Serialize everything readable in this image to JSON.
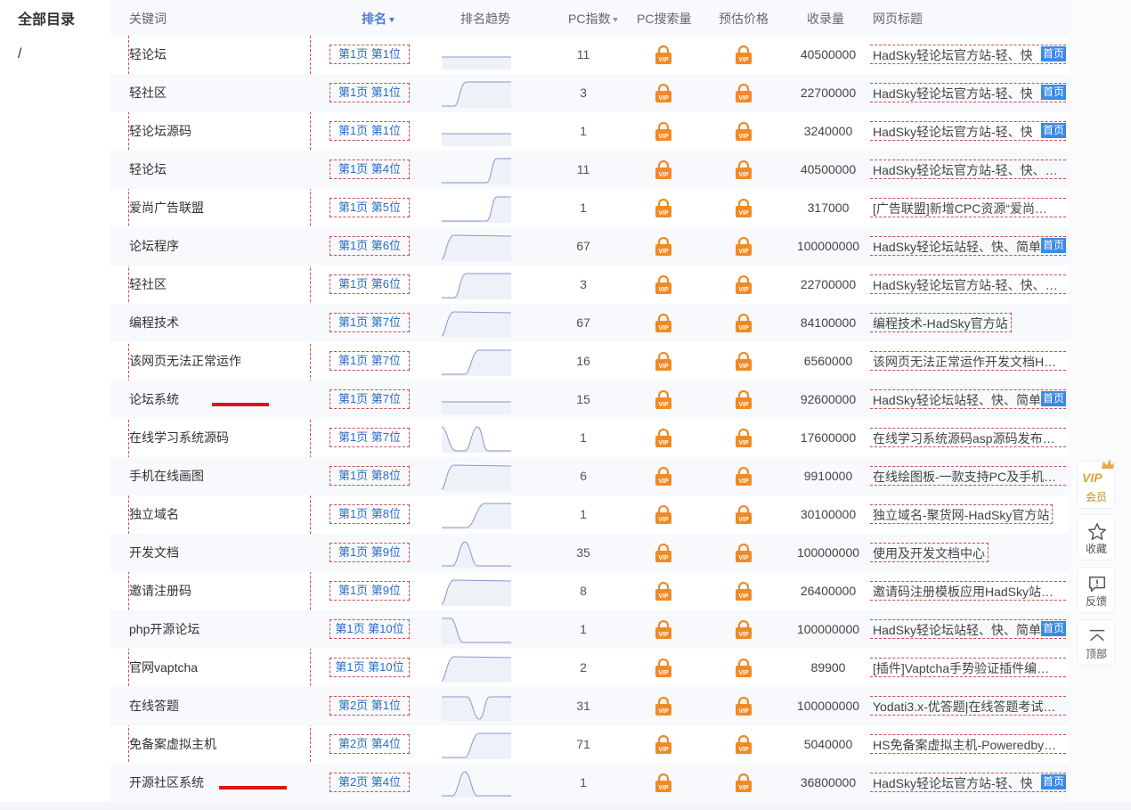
{
  "sidebar": {
    "title": "全部目录",
    "path": "/"
  },
  "table": {
    "headers": {
      "keyword": "关键词",
      "rank": "排名",
      "trend": "排名趋势",
      "pc_index": "PC指数",
      "pc_search": "PC搜索量",
      "price": "预估价格",
      "indexed": "收录量",
      "page_title": "网页标题"
    },
    "home_badge": "首页",
    "rows": [
      {
        "keyword": "轻论坛",
        "rank": "第1页 第1位",
        "pc_index": "11",
        "indexed": "40500000",
        "page_title": "HadSky轻论坛官方站-轻、快",
        "badge": true,
        "trend": "flat"
      },
      {
        "keyword": "轻社区",
        "rank": "第1页 第1位",
        "pc_index": "3",
        "indexed": "22700000",
        "page_title": "HadSky轻论坛官方站-轻、快",
        "badge": true,
        "trend": "rise-early"
      },
      {
        "keyword": "轻论坛源码",
        "rank": "第1页 第1位",
        "pc_index": "1",
        "indexed": "3240000",
        "page_title": "HadSky轻论坛官方站-轻、快",
        "badge": true,
        "trend": "flat"
      },
      {
        "keyword": "轻论坛",
        "rank": "第1页 第4位",
        "pc_index": "11",
        "indexed": "40500000",
        "page_title": "HadSky轻论坛官方站-轻、快、…",
        "badge": false,
        "trend": "rise-late"
      },
      {
        "keyword": "爱尚广告联盟",
        "rank": "第1页 第5位",
        "pc_index": "1",
        "indexed": "317000",
        "page_title": "[广告联盟]新增CPC资源“爱尚…",
        "badge": false,
        "trend": "rise-late"
      },
      {
        "keyword": "论坛程序",
        "rank": "第1页 第6位",
        "pc_index": "67",
        "indexed": "100000000",
        "page_title": "HadSky轻论坛站轻、快、简单",
        "badge": true,
        "trend": "rise-first"
      },
      {
        "keyword": "轻社区",
        "rank": "第1页 第6位",
        "pc_index": "3",
        "indexed": "22700000",
        "page_title": "HadSky轻论坛官方站-轻、快、…",
        "badge": false,
        "trend": "rise-early"
      },
      {
        "keyword": "编程技术",
        "rank": "第1页 第7位",
        "pc_index": "67",
        "indexed": "84100000",
        "page_title": "编程技术-HadSky官方站",
        "badge": false,
        "short": true,
        "trend": "rise-first"
      },
      {
        "keyword": "该网页无法正常运作",
        "rank": "第1页 第7位",
        "pc_index": "16",
        "indexed": "6560000",
        "page_title": "该网页无法正常运作开发文档H…",
        "badge": false,
        "trend": "rise-mid"
      },
      {
        "keyword": "论坛系统",
        "rank": "第1页 第7位",
        "pc_index": "15",
        "indexed": "92600000",
        "page_title": "HadSky轻论坛站轻、快、简单",
        "badge": true,
        "trend": "flat"
      },
      {
        "keyword": "在线学习系统源码",
        "rank": "第1页 第7位",
        "pc_index": "1",
        "indexed": "17600000",
        "page_title": "在线学习系统源码asp源码发布…",
        "badge": false,
        "trend": "dip-peak"
      },
      {
        "keyword": "手机在线画图",
        "rank": "第1页 第8位",
        "pc_index": "6",
        "indexed": "9910000",
        "page_title": "在线绘图板-一款支持PC及手机…",
        "badge": false,
        "trend": "rise-first"
      },
      {
        "keyword": "独立域名",
        "rank": "第1页 第8位",
        "pc_index": "1",
        "indexed": "30100000",
        "page_title": "独立域名-聚货网-HadSky官方站",
        "badge": false,
        "short": true,
        "trend": "valley-rise"
      },
      {
        "keyword": "开发文档",
        "rank": "第1页 第9位",
        "pc_index": "35",
        "indexed": "100000000",
        "page_title": "使用及开发文档中心",
        "badge": false,
        "short": true,
        "trend": "peak"
      },
      {
        "keyword": "邀请注册码",
        "rank": "第1页 第9位",
        "pc_index": "8",
        "indexed": "26400000",
        "page_title": "邀请码注册模板应用HadSky站…",
        "badge": false,
        "trend": "rise-first"
      },
      {
        "keyword": "php开源论坛",
        "rank": "第1页 第10位",
        "pc_index": "1",
        "indexed": "100000000",
        "page_title": "HadSky轻论坛站轻、快、简单",
        "badge": true,
        "trend": "drop"
      },
      {
        "keyword": "官网vaptcha",
        "rank": "第1页 第10位",
        "pc_index": "2",
        "indexed": "89900",
        "page_title": "[插件]Vaptcha手势验证插件编…",
        "badge": false,
        "trend": "rise-first"
      },
      {
        "keyword": "在线答题",
        "rank": "第2页 第1位",
        "pc_index": "31",
        "indexed": "100000000",
        "page_title": "Yodati3.x-优答题|在线答题考试…",
        "badge": false,
        "trend": "valley"
      },
      {
        "keyword": "免备案虚拟主机",
        "rank": "第2页 第4位",
        "pc_index": "71",
        "indexed": "5040000",
        "page_title": "HS免备案虚拟主机-Poweredby…",
        "badge": false,
        "trend": "rise-mid"
      },
      {
        "keyword": "开源社区系统",
        "rank": "第2页 第4位",
        "pc_index": "1",
        "indexed": "36800000",
        "page_title": "HadSky轻论坛官方站-轻、快",
        "badge": true,
        "trend": "peak"
      }
    ]
  },
  "side_tools": {
    "vip_text": "VIP",
    "vip_label": "会员",
    "favorite_label": "收藏",
    "feedback_label": "反馈",
    "top_label": "顶部"
  },
  "colors": {
    "accent": "#3a8ae6",
    "link": "#2b6cc4",
    "vip": "#f08a24",
    "mark": "#e0141b"
  }
}
